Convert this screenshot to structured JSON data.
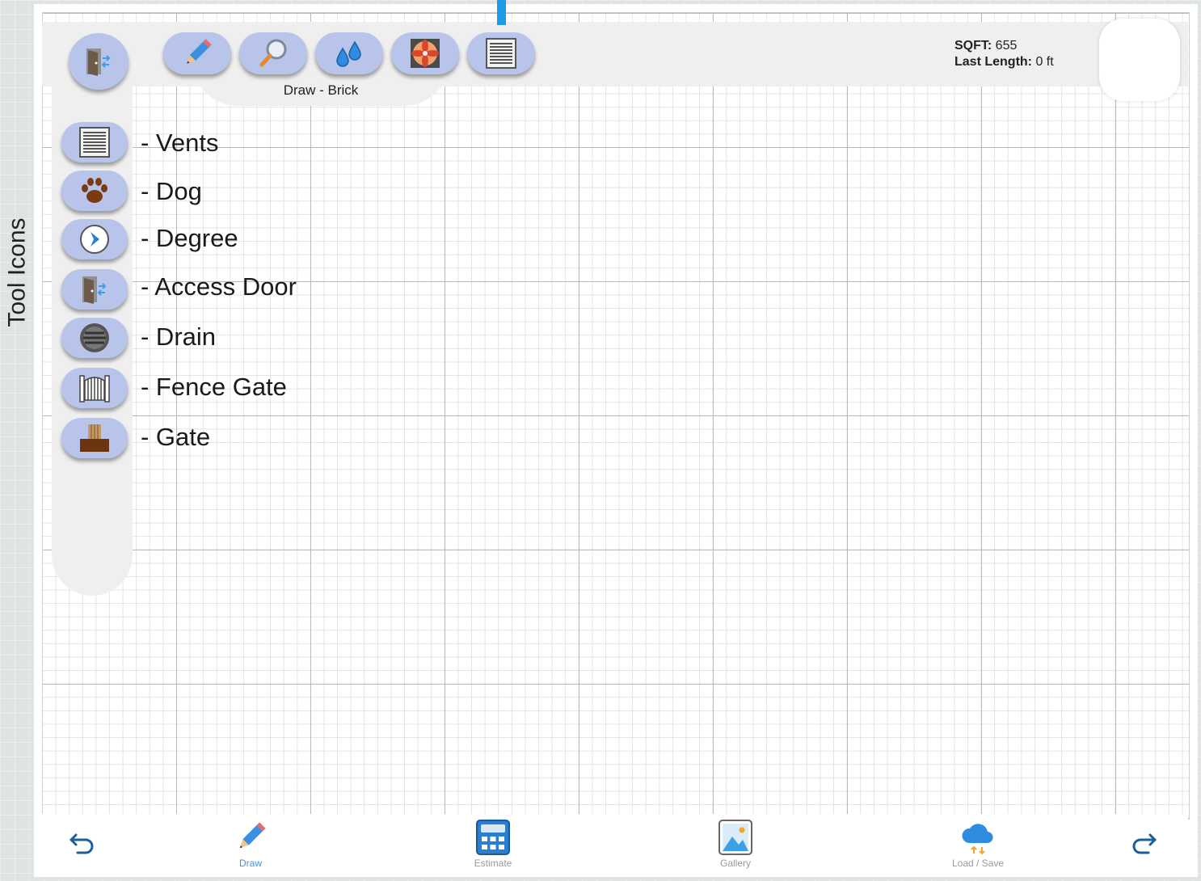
{
  "annotation": {
    "side_caption": "Tool Icons",
    "accent_color": "#1e9be6"
  },
  "toolbar": {
    "buttons": [
      {
        "icon": "pencil-icon"
      },
      {
        "icon": "magnifier-icon"
      },
      {
        "icon": "water-drops-icon"
      },
      {
        "icon": "fan-icon"
      },
      {
        "icon": "vent-icon"
      }
    ],
    "mode_label": "Draw - Brick",
    "door_icon": "access-door-icon",
    "button_color": "#b9c4ea"
  },
  "stats": {
    "sqft_label": "SQFT:",
    "sqft_value": " 655",
    "length_label": "Last Length:",
    "length_value": " 0 ft"
  },
  "tools": [
    {
      "label": "- Vents",
      "icon": "vent-icon"
    },
    {
      "label": "- Dog",
      "icon": "paw-icon"
    },
    {
      "label": "- Degree",
      "icon": "degree-arrow-icon"
    },
    {
      "label": "- Access Door",
      "icon": "access-door-icon"
    },
    {
      "label": "- Drain",
      "icon": "drain-icon"
    },
    {
      "label": "- Fence Gate",
      "icon": "fence-gate-icon"
    },
    {
      "label": "- Gate",
      "icon": "gate-icon"
    }
  ],
  "bottom_nav": {
    "items": [
      {
        "label": "Draw",
        "icon": "pencil-icon",
        "active": true
      },
      {
        "label": "Estimate",
        "icon": "calculator-icon",
        "active": false
      },
      {
        "label": "Gallery",
        "icon": "gallery-icon",
        "active": false
      },
      {
        "label": "Load / Save",
        "icon": "cloud-sync-icon",
        "active": false
      }
    ],
    "undo_icon": "undo-icon",
    "redo_icon": "redo-icon",
    "active_color": "#4a90d9"
  }
}
